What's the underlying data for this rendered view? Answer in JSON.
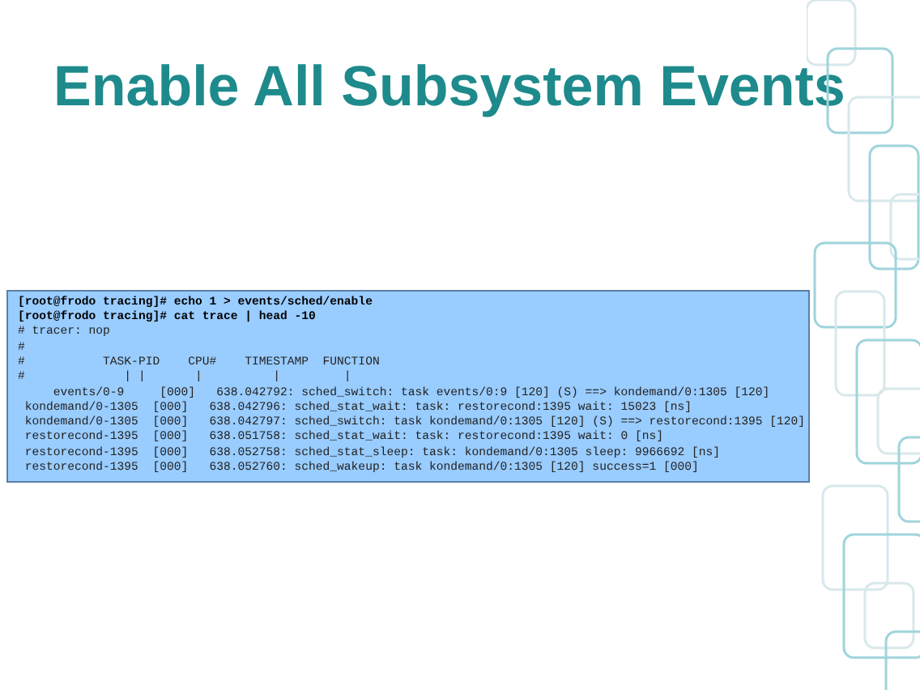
{
  "title": "Enable All Subsystem Events",
  "terminal": {
    "lines": [
      {
        "text": "[root@frodo tracing]# echo 1 > events/sched/enable",
        "kind": "command"
      },
      {
        "text": "[root@frodo tracing]# cat trace | head -10",
        "kind": "command"
      },
      {
        "text": "# tracer: nop",
        "kind": "output"
      },
      {
        "text": "#",
        "kind": "output"
      },
      {
        "text": "#           TASK-PID    CPU#    TIMESTAMP  FUNCTION",
        "kind": "output"
      },
      {
        "text": "#              | |       |          |         |",
        "kind": "output"
      },
      {
        "text": "     events/0-9     [000]   638.042792: sched_switch: task events/0:9 [120] (S) ==> kondemand/0:1305 [120]",
        "kind": "output"
      },
      {
        "text": " kondemand/0-1305  [000]   638.042796: sched_stat_wait: task: restorecond:1395 wait: 15023 [ns]",
        "kind": "output"
      },
      {
        "text": " kondemand/0-1305  [000]   638.042797: sched_switch: task kondemand/0:1305 [120] (S) ==> restorecond:1395 [120]",
        "kind": "output"
      },
      {
        "text": " restorecond-1395  [000]   638.051758: sched_stat_wait: task: restorecond:1395 wait: 0 [ns]",
        "kind": "output"
      },
      {
        "text": " restorecond-1395  [000]   638.052758: sched_stat_sleep: task: kondemand/0:1305 sleep: 9966692 [ns]",
        "kind": "output"
      },
      {
        "text": " restorecond-1395  [000]   638.052760: sched_wakeup: task kondemand/0:1305 [120] success=1 [000]",
        "kind": "output"
      }
    ]
  }
}
